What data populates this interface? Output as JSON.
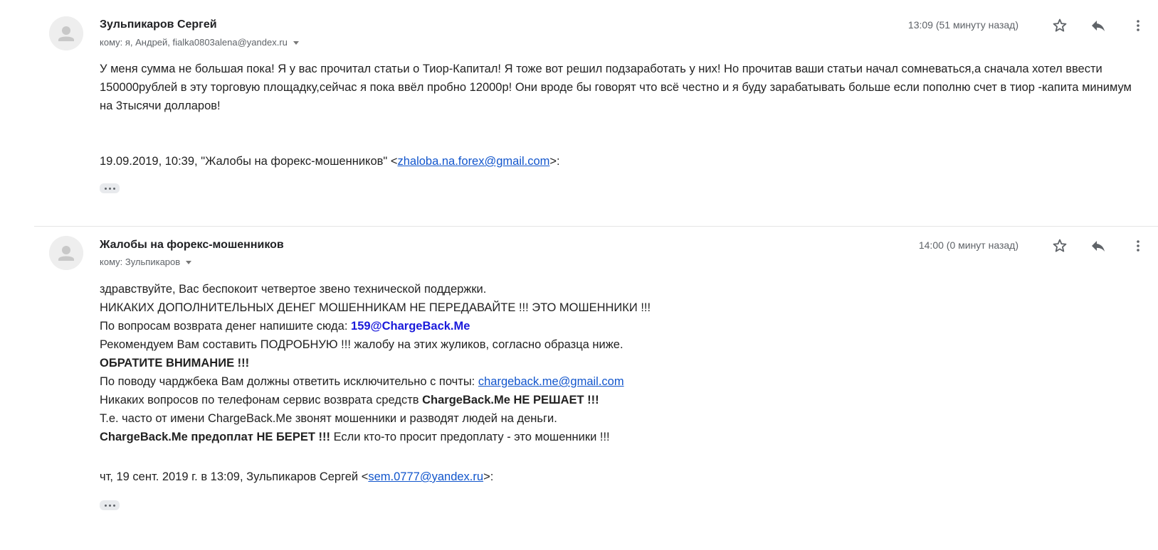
{
  "messages": [
    {
      "sender": "Зульпикаров Сергей",
      "to_label": "кому: я, Андрей, fialka0803alena@yandex.ru",
      "time": "13:09 (51 минуту назад)",
      "body": "У меня сумма не большая пока! Я у вас прочитал статьи о Тиор-Капитал! Я тоже вот решил подзаработать у них! Но прочитав ваши статьи начал сомневаться,а сначала хотел ввести 150000рублей в эту торговую площадку,сейчас я пока ввёл пробно 12000р! Они вроде бы говорят что всё честно и я буду зарабатывать больше если пополню счет в тиор -капита минимум на 3тысячи долларов!",
      "quote_prefix": "19.09.2019, 10:39, \"Жалобы на форекс-мошенников\" <",
      "quote_email": "zhaloba.na.forex@gmail.com",
      "quote_suffix": ">:"
    },
    {
      "sender": "Жалобы на форекс-мошенников",
      "to_label": "кому: Зульпикаров",
      "time": "14:00 (0 минут назад)",
      "lines": {
        "l1": "здравствуйте, Вас беспокоит четвертое звено технической поддержки.",
        "l2": "НИКАКИХ ДОПОЛНИТЕЛЬНЫХ ДЕНЕГ МОШЕННИКАМ НЕ ПЕРЕДАВАЙТЕ !!! ЭТО МОШЕННИКИ !!!",
        "l3_text": "По вопросам возврата денег напишите сюда: ",
        "l3_bold": "159@ChargeBack.Me",
        "l4": "Рекомендуем Вам составить ПОДРОБНУЮ !!! жалобу на этих жуликов, согласно образца ниже.",
        "l5": "ОБРАТИТЕ ВНИМАНИЕ !!!",
        "l6_text": "По поводу чарджбека Вам должны ответить исключительно с почты: ",
        "l6_link": "chargeback.me@gmail.com",
        "l7_text": "Никаких вопросов по телефонам сервис возврата средств ",
        "l7_bold": "ChargeBack.Me НЕ РЕШАЕТ !!!",
        "l8": "Т.е. часто от имени ChargeBack.Me звонят мошенники и разводят людей на деньги.",
        "l9_bold": "ChargeBack.Me предоплат НЕ БЕРЕТ !!!",
        "l9_text": " Если кто-то просит предоплату - это мошенники !!!"
      },
      "quote_prefix": "чт, 19 сент. 2019 г. в 13:09, Зульпикаров Сергей <",
      "quote_email": "sem.0777@yandex.ru",
      "quote_suffix": ">:"
    }
  ],
  "icons": {
    "avatar": "person-icon",
    "star": "star-icon",
    "reply": "reply-icon",
    "more": "more-vertical-icon",
    "expand": "ellipsis-icon"
  },
  "colors": {
    "link": "#1155cc",
    "bold_link": "#1a1adb",
    "muted": "#5f6368"
  }
}
